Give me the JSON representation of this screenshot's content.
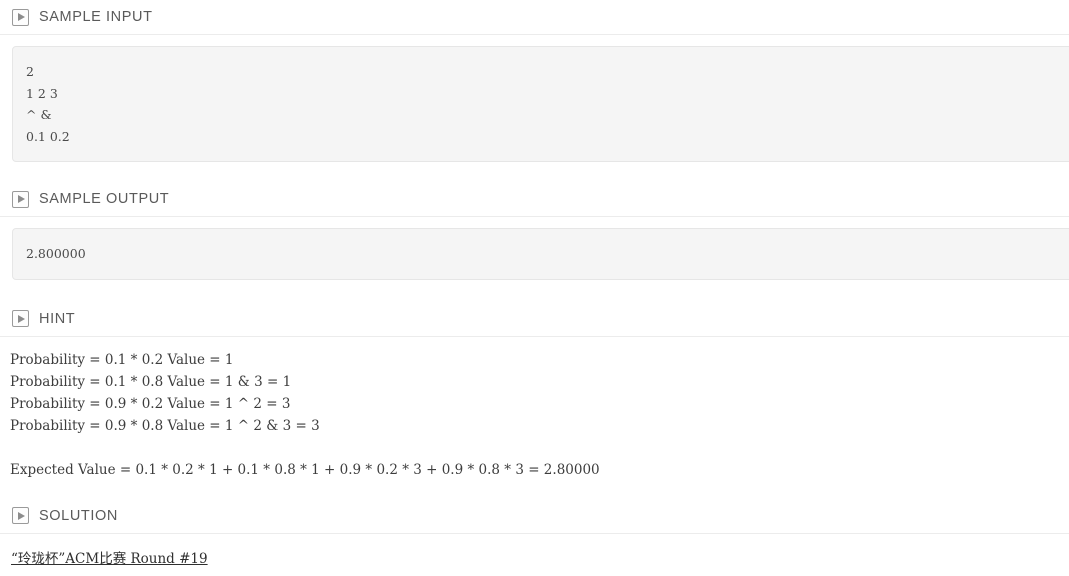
{
  "sections": [
    {
      "id": "sample-input",
      "icon": "play-icon",
      "title": "SAMPLE INPUT",
      "code_lines": [
        "2",
        "1 2 3",
        "^ &",
        "0.1 0.2"
      ]
    },
    {
      "id": "sample-output",
      "icon": "play-icon",
      "title": "SAMPLE OUTPUT",
      "code_lines": [
        "2.800000"
      ]
    },
    {
      "id": "hint",
      "icon": "play-icon",
      "title": "HINT",
      "hint_lines": [
        "Probability = 0.1 * 0.2 Value = 1",
        "Probability = 0.1 * 0.8 Value = 1 & 3 = 1",
        "Probability = 0.9 * 0.2 Value = 1 ^ 2 = 3",
        "Probability = 0.9 * 0.8 Value = 1 ^ 2 & 3 = 3"
      ],
      "expected_value": "Expected Value = 0.1 * 0.2 * 1 + 0.1 * 0.8 * 1 + 0.9 * 0.2 * 3 + 0.9 * 0.8 * 3 = 2.80000"
    },
    {
      "id": "solution",
      "icon": "play-icon",
      "title": "SOLUTION",
      "link_text": "“玲珑杯”ACM比赛 Round #19"
    }
  ],
  "colors": {
    "page_background": "#ffffff",
    "code_background": "#f5f5f5",
    "code_border": "#e6e6e6",
    "divider": "#ececec",
    "heading_text": "#5a5a5a",
    "body_text": "#3d3d3d",
    "icon_stroke": "#9a9a9a"
  }
}
